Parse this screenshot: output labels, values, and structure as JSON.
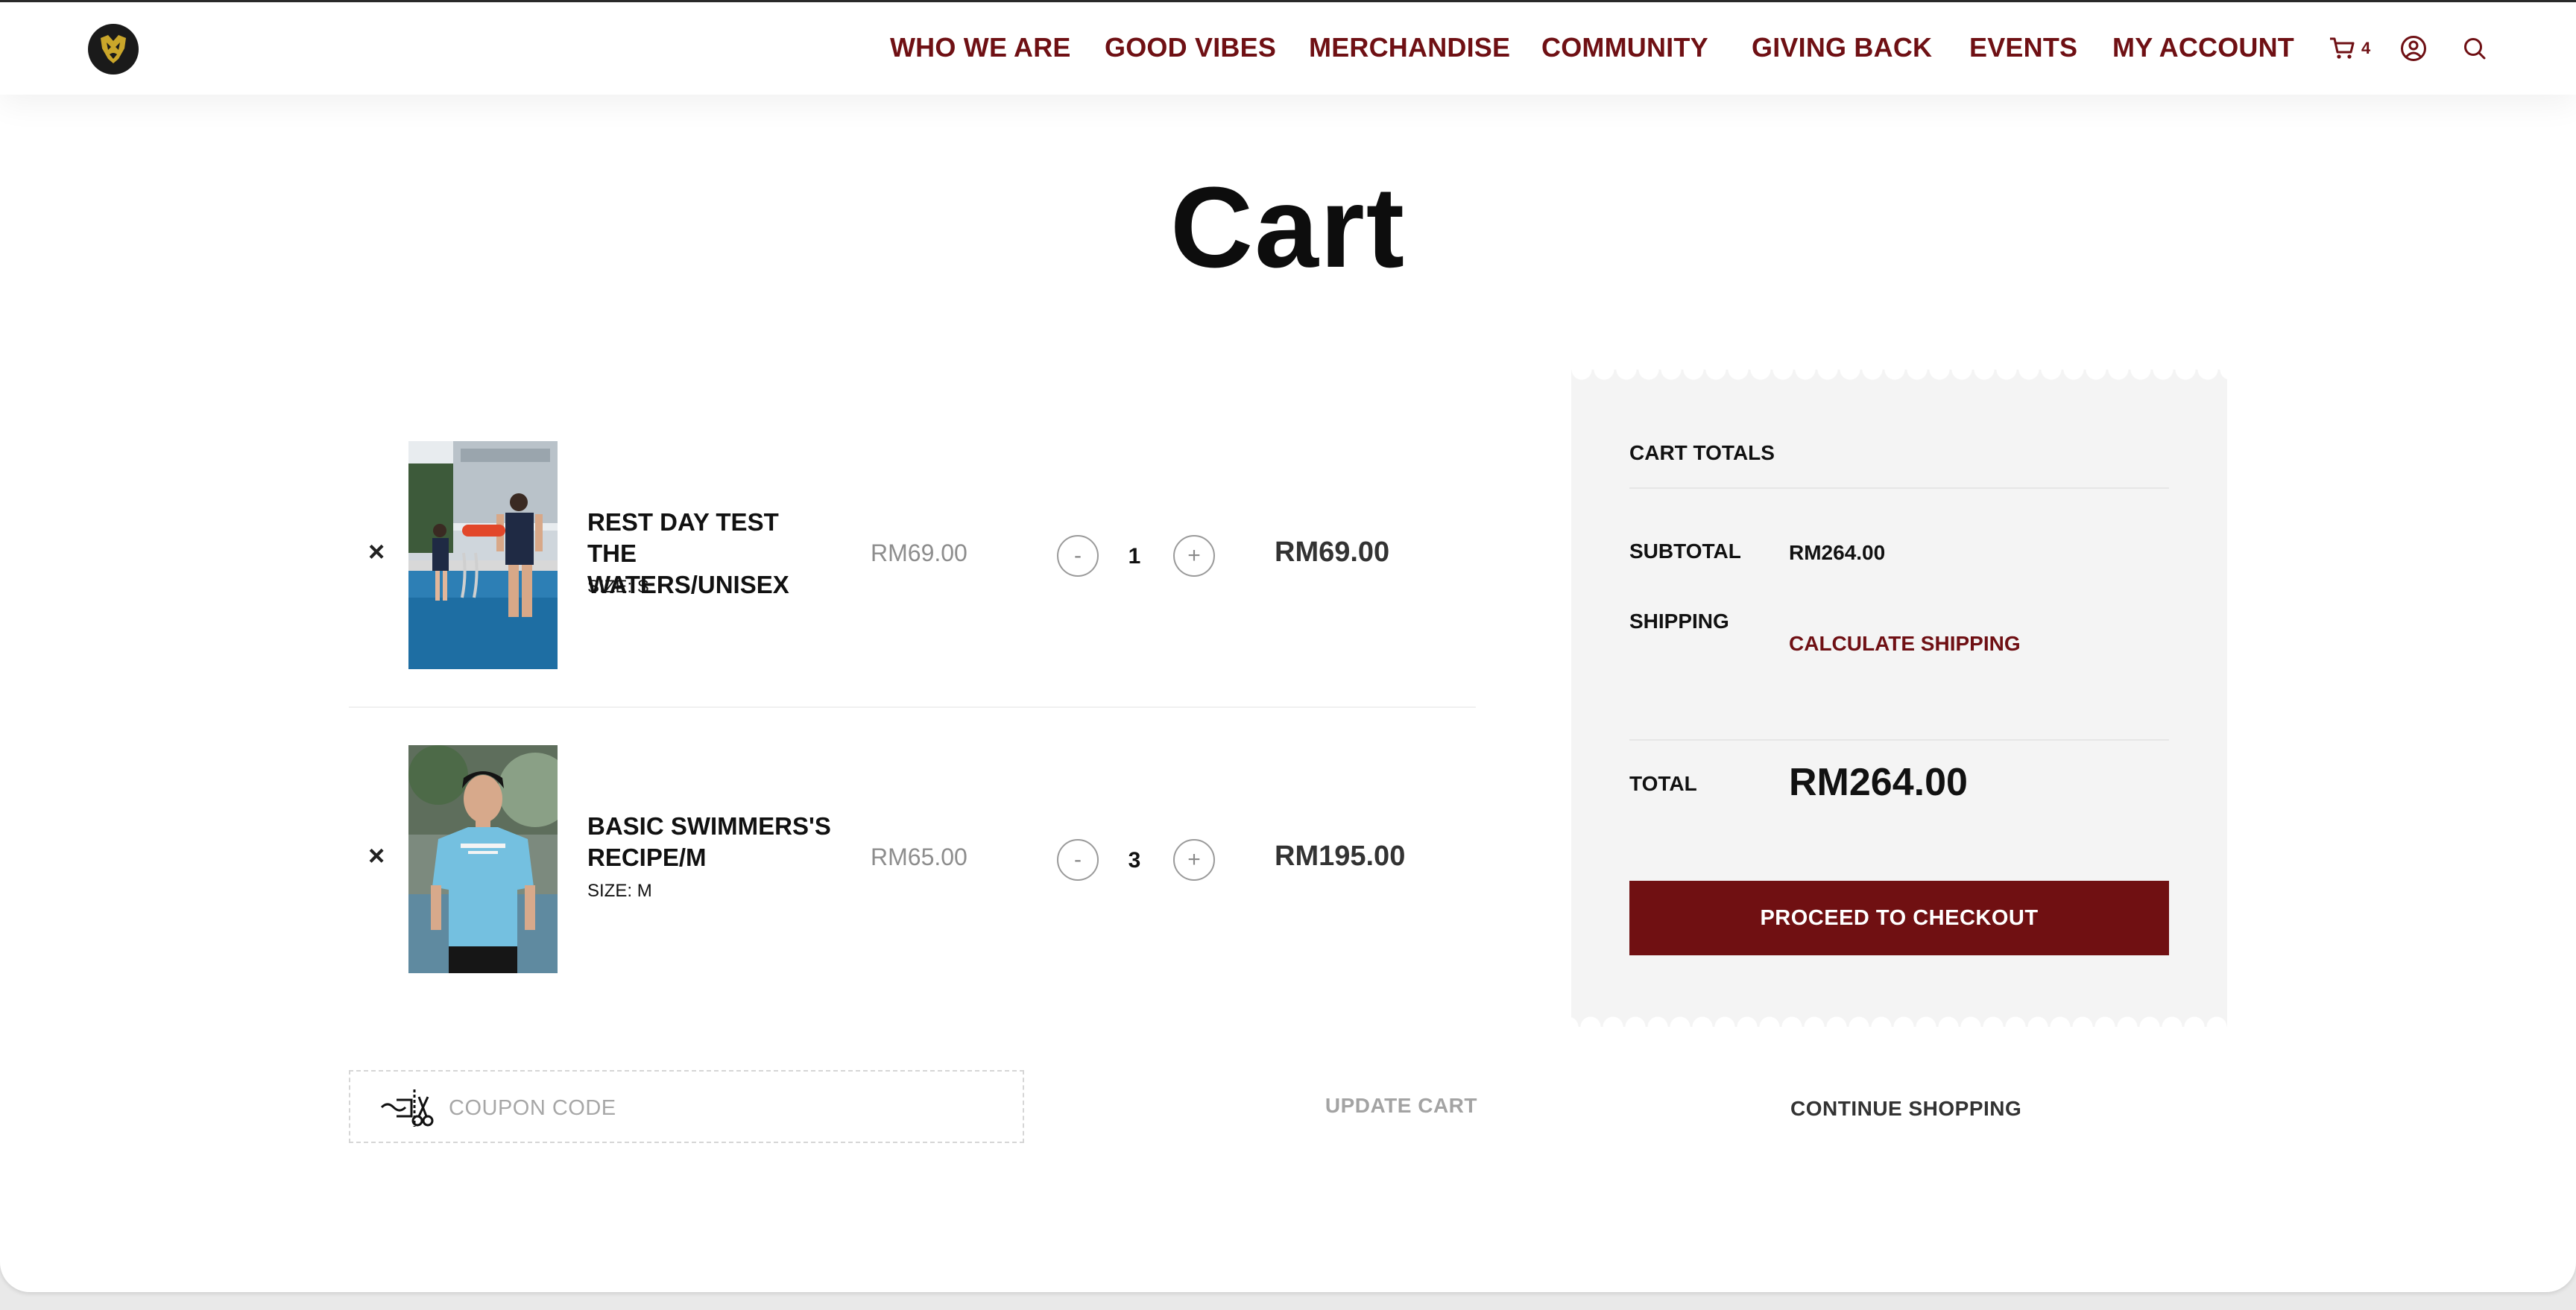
{
  "nav": {
    "items": [
      "WHO WE ARE",
      "GOOD VIBES",
      "MERCHANDISE",
      "COMMUNITY",
      "GIVING BACK",
      "EVENTS",
      "MY ACCOUNT"
    ],
    "cart_count": "4"
  },
  "page_title": "Cart",
  "cart": {
    "items": [
      {
        "name": "REST DAY TEST THE WATERS/UNISEX",
        "size_label": "SIZE:",
        "size": "S",
        "price": "RM69.00",
        "quantity": "1",
        "subtotal": "RM69.00",
        "decrement": "-",
        "increment": "+",
        "remove": "×"
      },
      {
        "name": "BASIC SWIMMERS'S RECIPE/M",
        "size_label": "SIZE:",
        "size": "M",
        "price": "RM65.00",
        "quantity": "3",
        "subtotal": "RM195.00",
        "decrement": "-",
        "increment": "+",
        "remove": "×"
      }
    ],
    "coupon_placeholder": "COUPON CODE",
    "update_label": "UPDATE CART"
  },
  "totals": {
    "heading": "CART TOTALS",
    "subtotal_label": "SUBTOTAL",
    "subtotal_value": "RM264.00",
    "shipping_label": "SHIPPING",
    "shipping_link": "CALCULATE SHIPPING",
    "total_label": "TOTAL",
    "total_value": "RM264.00",
    "checkout_label": "PROCEED TO CHECKOUT",
    "continue_label": "CONTINUE SHOPPING"
  },
  "colors": {
    "brand": "#6f1014",
    "checkout": "#701012",
    "panel": "#f4f4f4"
  },
  "icons": [
    "logo-icon",
    "cart-icon",
    "account-icon",
    "search-icon",
    "remove-icon",
    "coupon-scissors-icon"
  ]
}
